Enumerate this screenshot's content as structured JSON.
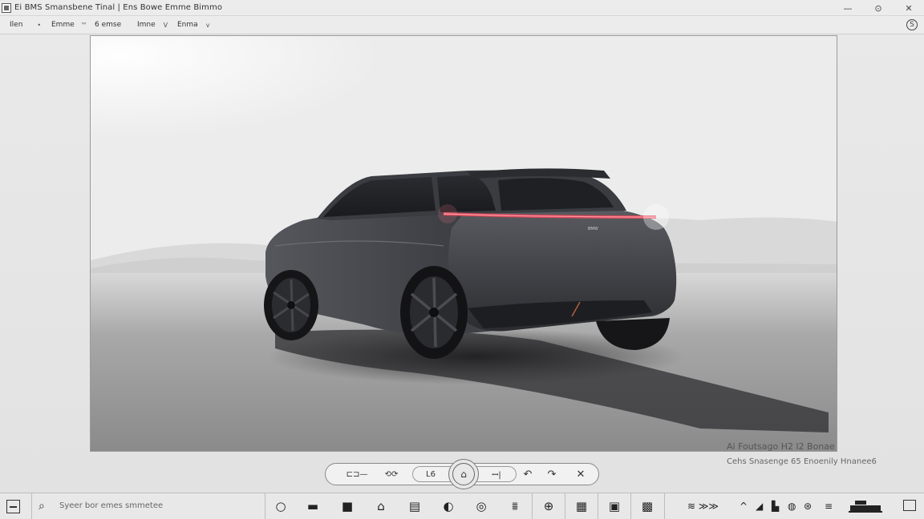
{
  "window": {
    "title": "Ei BMS Smansbene Tinal | Ens Bowe Emme Bimmo",
    "minimize_glyph": "—",
    "maximize_glyph": "⊙",
    "close_glyph": "✕"
  },
  "menubar": {
    "items": [
      {
        "label": "Ilen",
        "caret": "•"
      },
      {
        "label": "Emme",
        "caret": "™"
      },
      {
        "label": "6 emse",
        "caret": ""
      },
      {
        "label": "Imne",
        "caret": "V"
      },
      {
        "label": "Enma",
        "caret": "v"
      }
    ],
    "right_icon": "S"
  },
  "canvas": {
    "watermark_line1": "Ai Foutsago H2 l2 Bonae",
    "watermark_line2": "Cehs Snasenge 65 Enoenily Hnanee6",
    "badge": "BMW"
  },
  "image_toolbar": {
    "items": [
      {
        "label": "⊏⊐—",
        "icon": "adjust-icon"
      },
      {
        "label": "⟲⟳",
        "icon": "rotate-icon"
      },
      {
        "label": "L6",
        "icon": "crop-icon"
      },
      {
        "label": "⌂",
        "icon": "home-icon"
      },
      {
        "label": "ꟷ|",
        "icon": "resize-icon"
      },
      {
        "label": "↶",
        "icon": "undo-icon"
      },
      {
        "label": "↷",
        "icon": "redo-icon"
      },
      {
        "label": "✕",
        "icon": "close-icon"
      }
    ]
  },
  "taskbar": {
    "search_placeholder": "Syeer bor emes smmetee",
    "apps": [
      "○",
      "▬",
      "■",
      "⌂",
      "▤",
      "◐",
      "◎",
      "⩩",
      "⊕",
      "▦",
      "▣",
      "▩"
    ],
    "tray": [
      "≋ ≫≫",
      "^",
      "◢",
      "▙",
      "◍",
      "⊛",
      "≡"
    ]
  }
}
